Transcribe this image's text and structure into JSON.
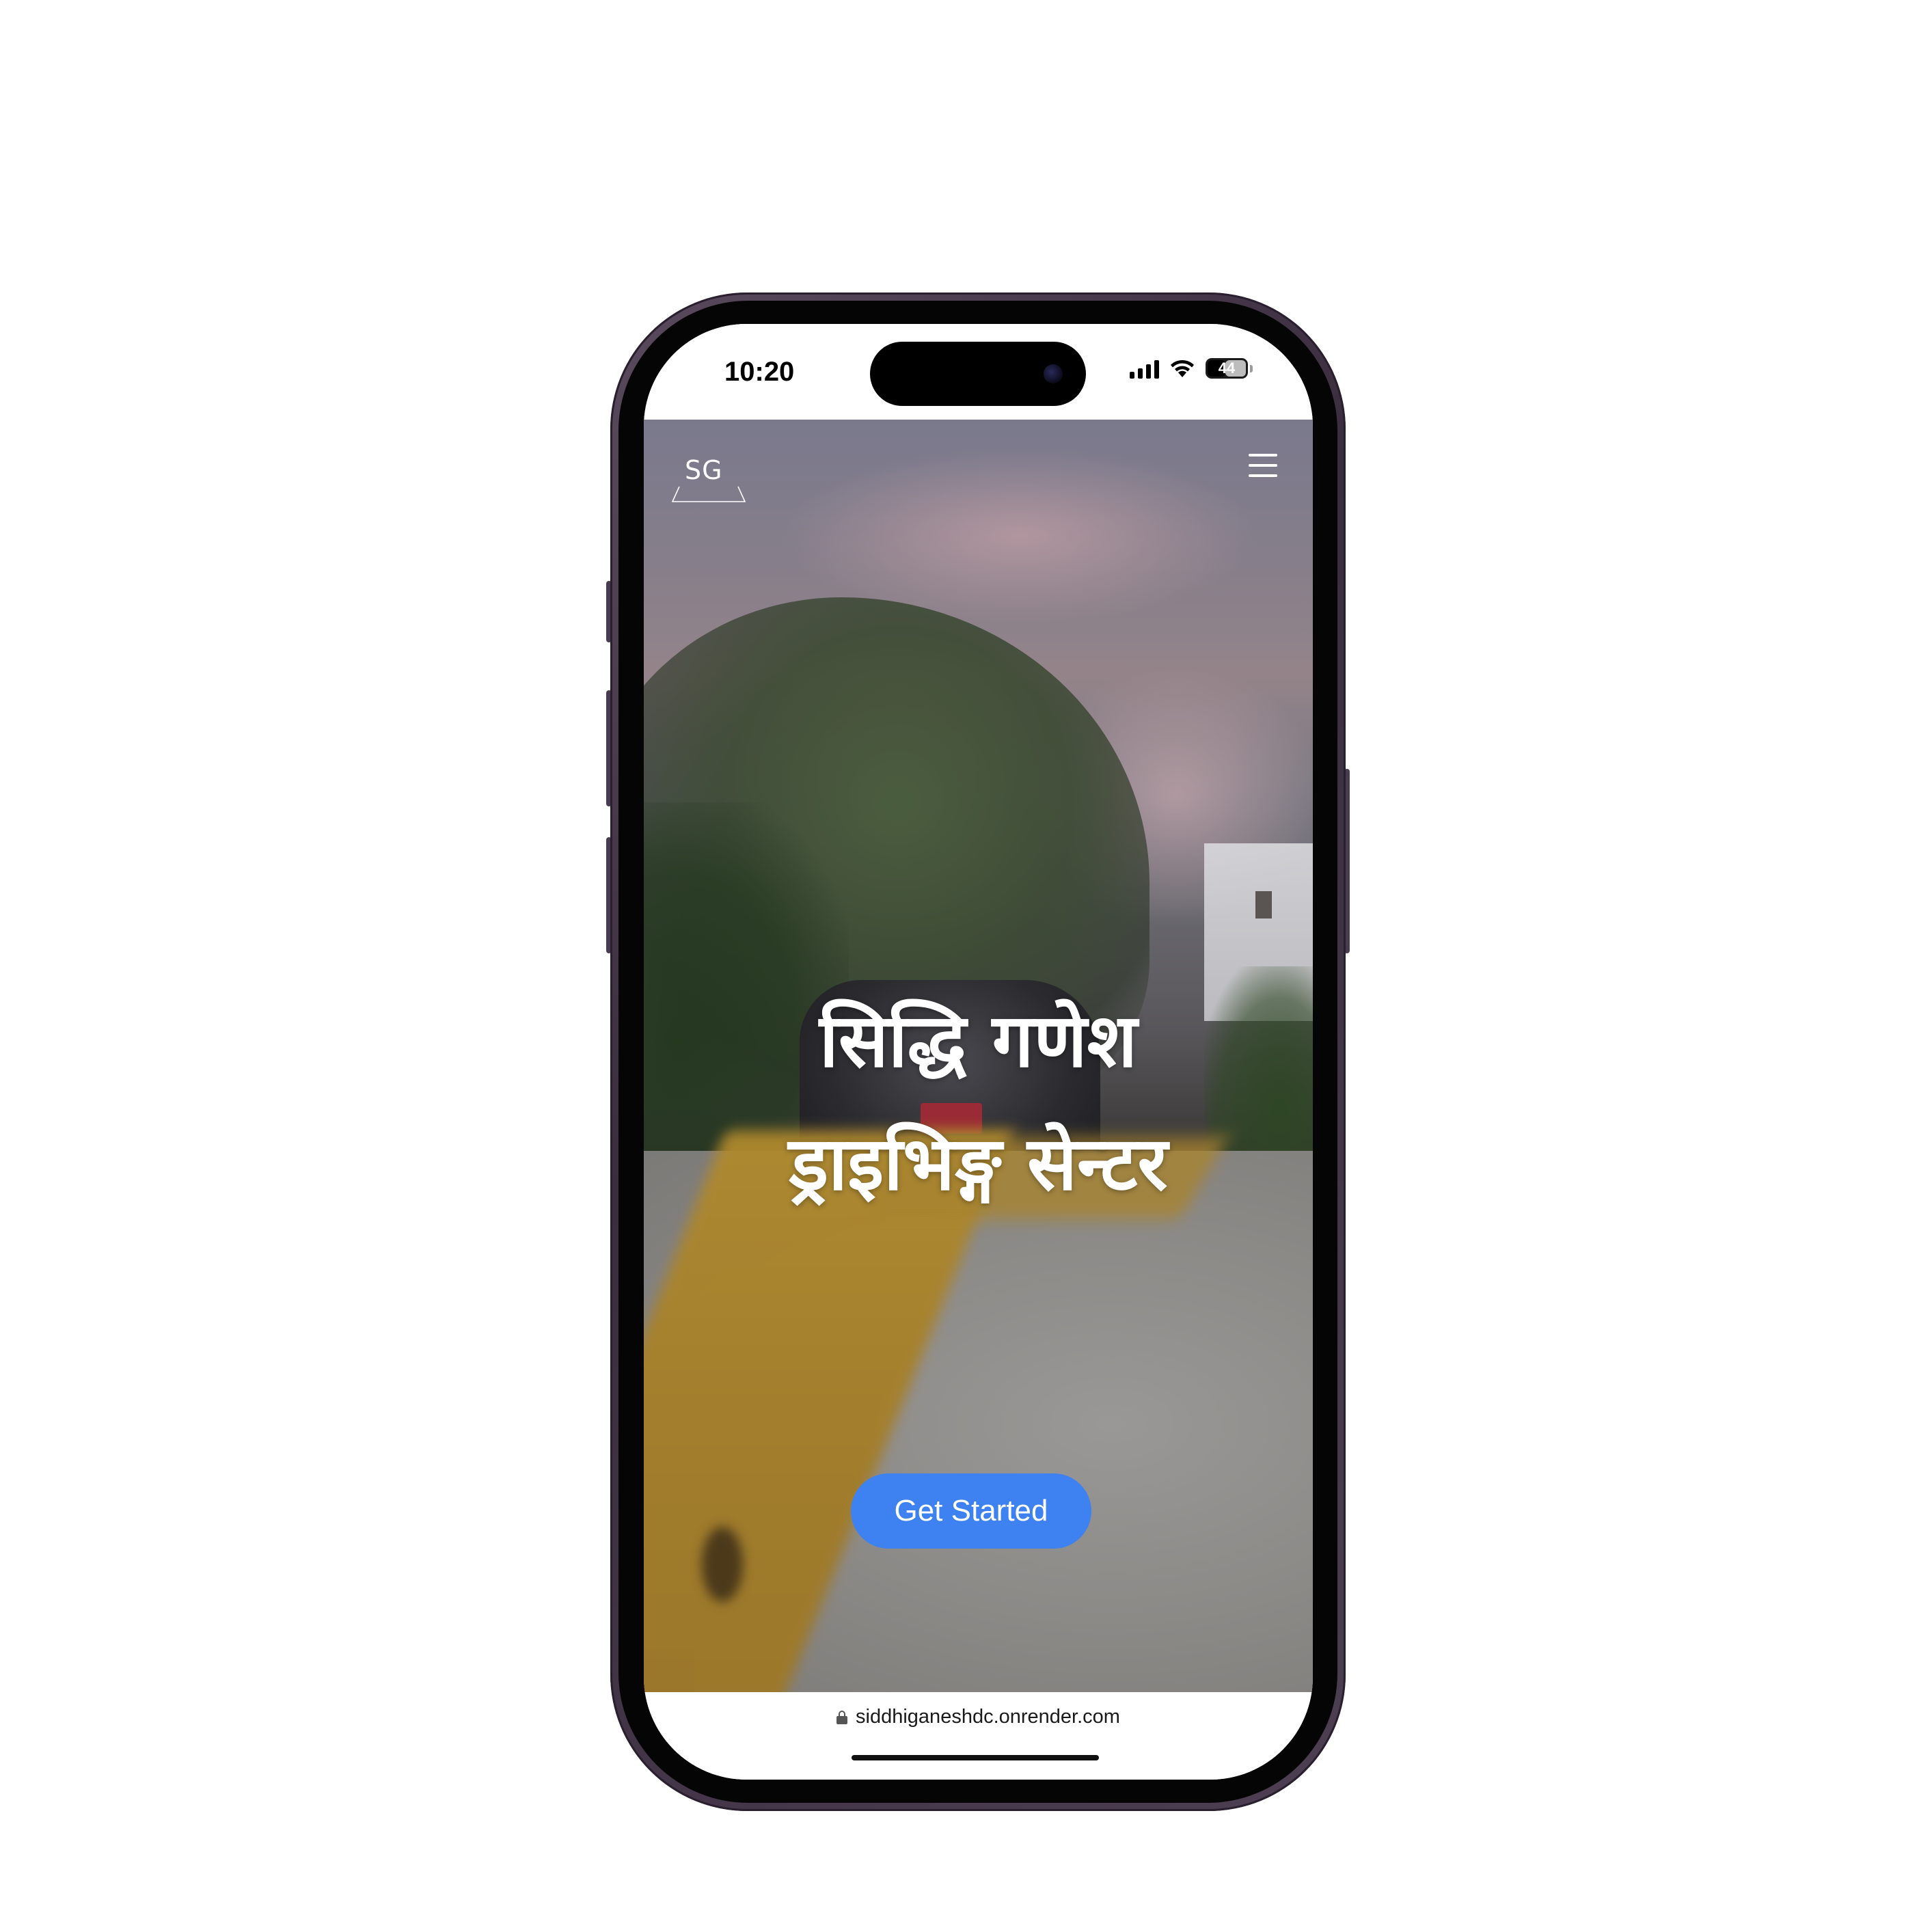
{
  "status_bar": {
    "time": "10:20",
    "battery_level": "44",
    "signal_icon": "cellular-signal-icon",
    "wifi_icon": "wifi-icon",
    "battery_icon": "battery-icon"
  },
  "site": {
    "logo_text": "SG",
    "menu_icon": "hamburger-menu-icon"
  },
  "hero": {
    "title_line1": "सिद्धि गणेश",
    "title_line2": "ड्राइभिङ्ग सेन्टर",
    "cta_label": "Get Started"
  },
  "browser": {
    "url": "siddhiganeshdc.onrender.com",
    "lock_icon": "lock-icon"
  },
  "colors": {
    "cta_background": "#3d82f0",
    "text_on_hero": "#ffffff",
    "phone_frame": "#4d3f52"
  }
}
